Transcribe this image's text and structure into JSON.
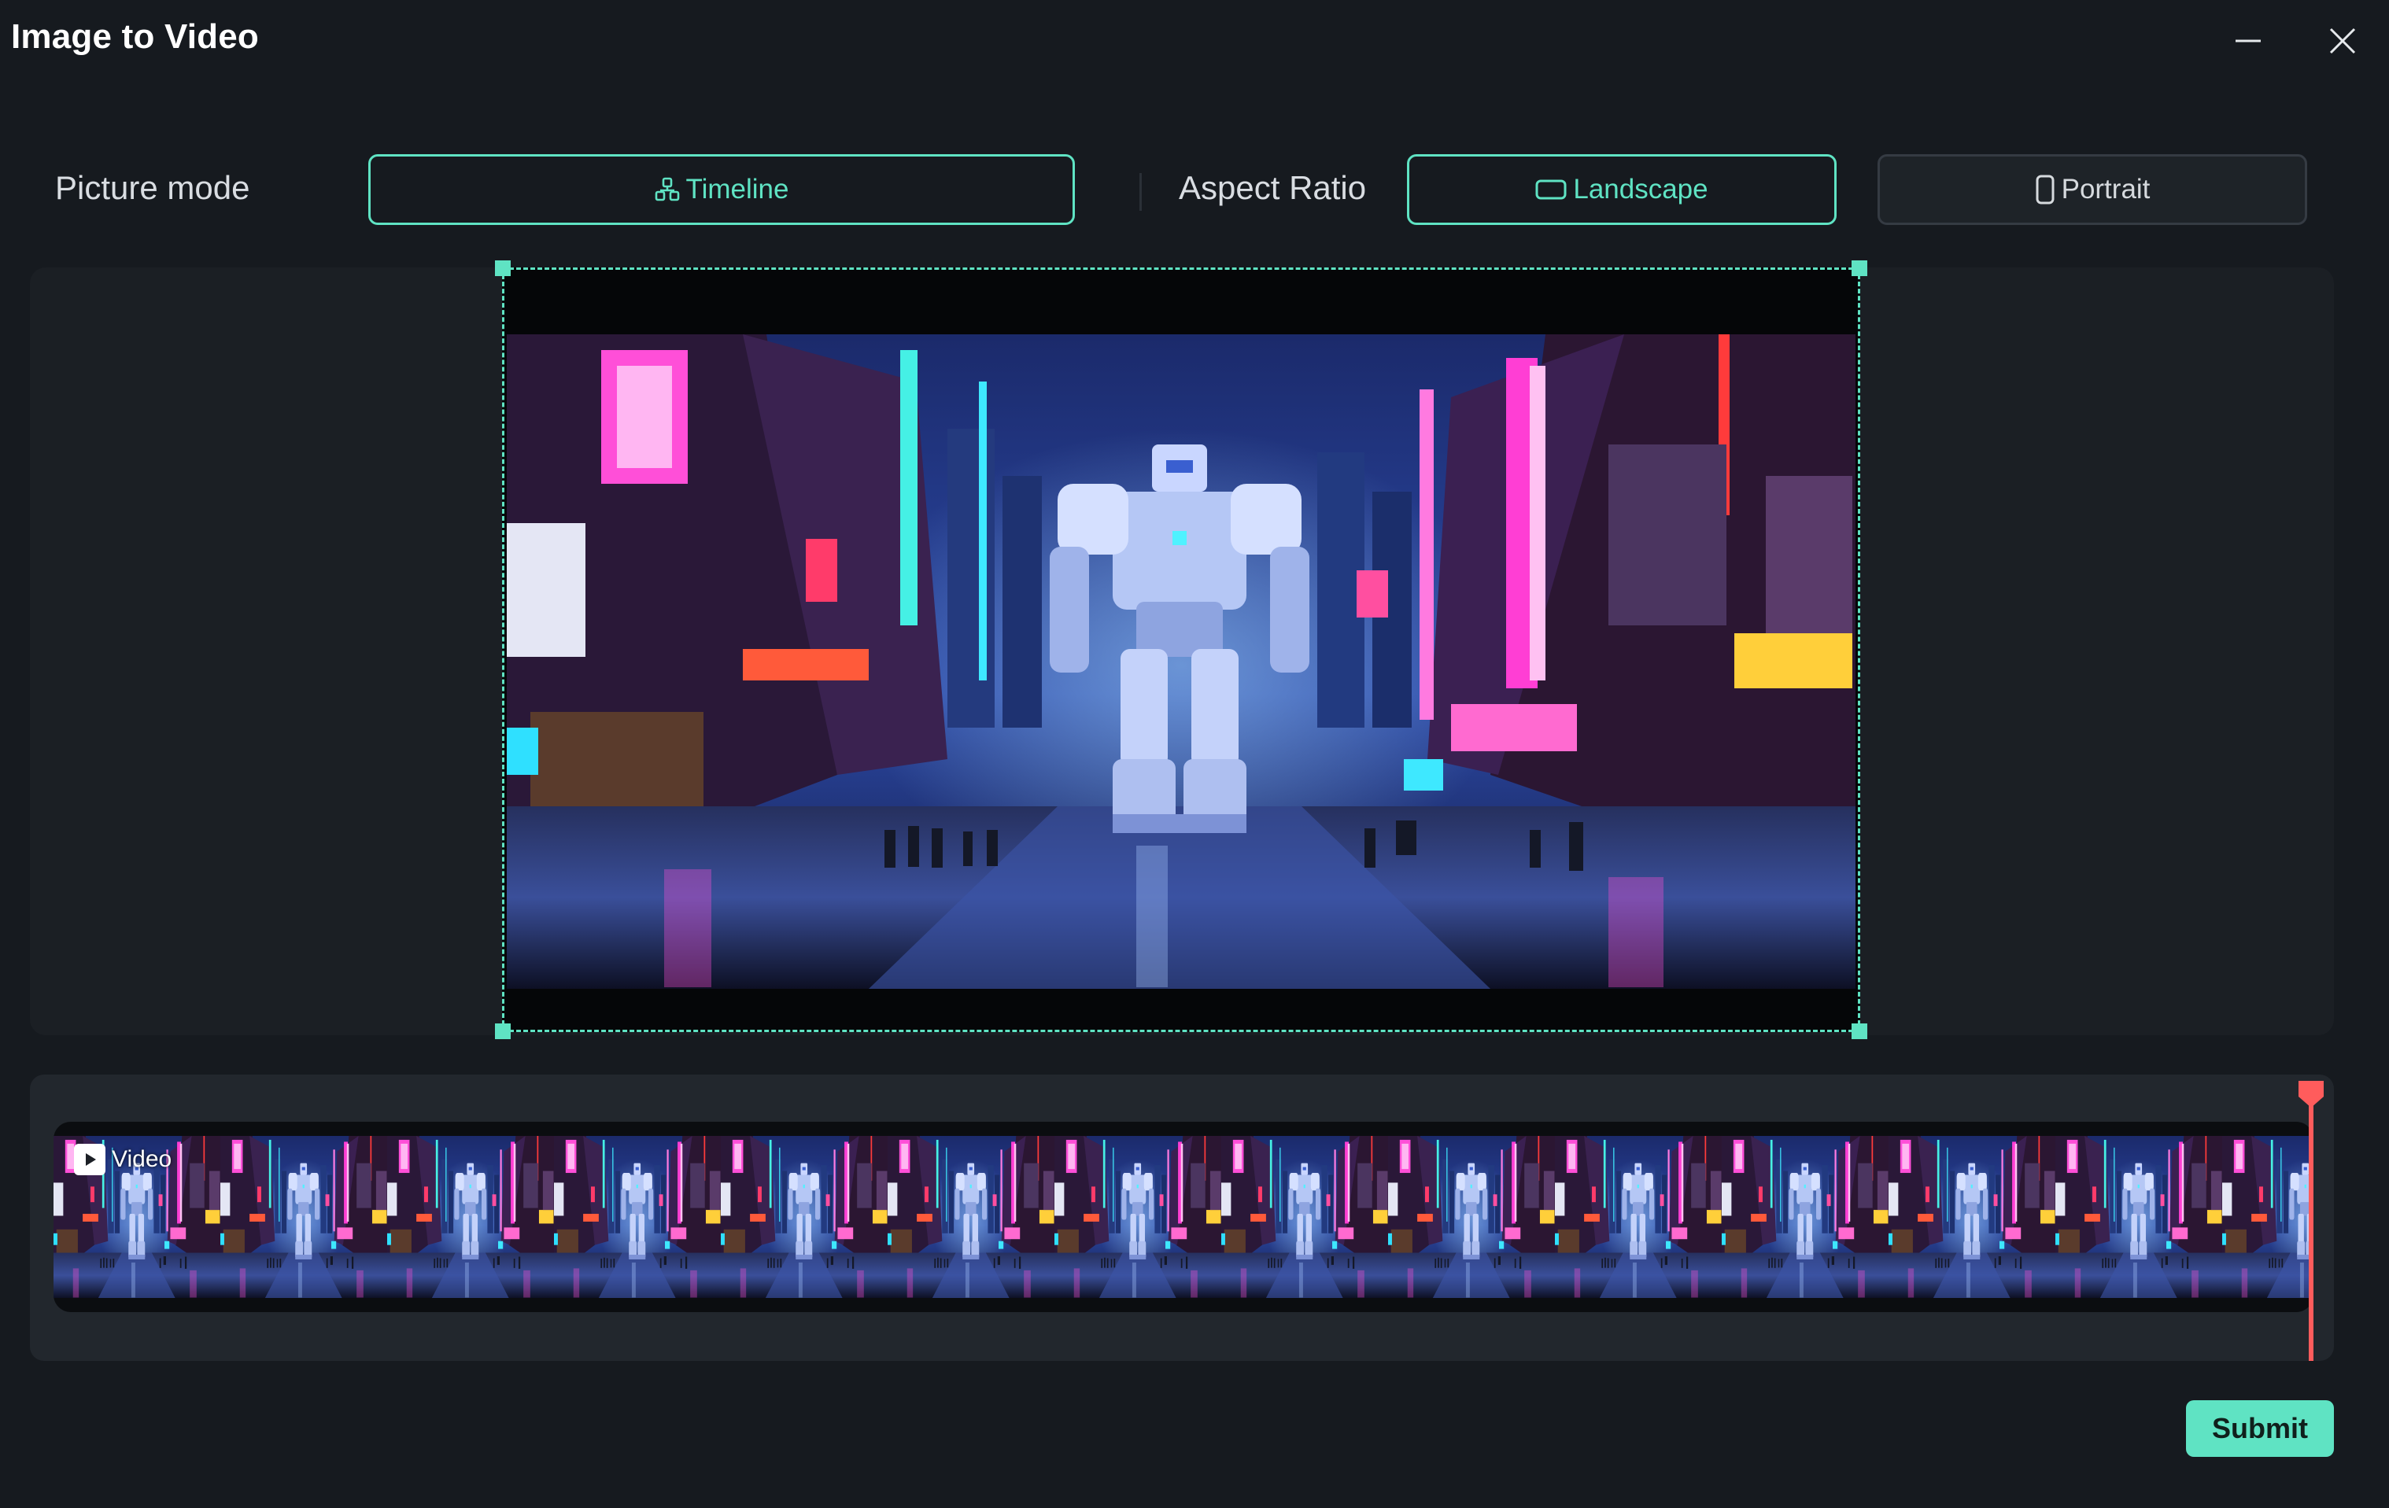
{
  "window": {
    "title": "Image to Video"
  },
  "options": {
    "picture_mode_label": "Picture mode",
    "timeline_label": "Timeline",
    "aspect_ratio_label": "Aspect Ratio",
    "landscape_label": "Landscape",
    "portrait_label": "Portrait",
    "selected_picture_mode": "Timeline",
    "selected_aspect_ratio": "Landscape"
  },
  "timeline": {
    "clip_label": "Video"
  },
  "footer": {
    "submit_label": "Submit"
  },
  "colors": {
    "accent": "#5fe3c3",
    "background": "#161a1f",
    "panel": "#1b1f24",
    "playhead": "#ff5c5c"
  },
  "icons": {
    "minimize": "minimize-icon",
    "close": "close-icon",
    "timeline": "timeline-icon",
    "landscape": "landscape-icon",
    "portrait": "portrait-icon",
    "clip": "play-icon",
    "playhead": "playhead-marker-icon"
  }
}
